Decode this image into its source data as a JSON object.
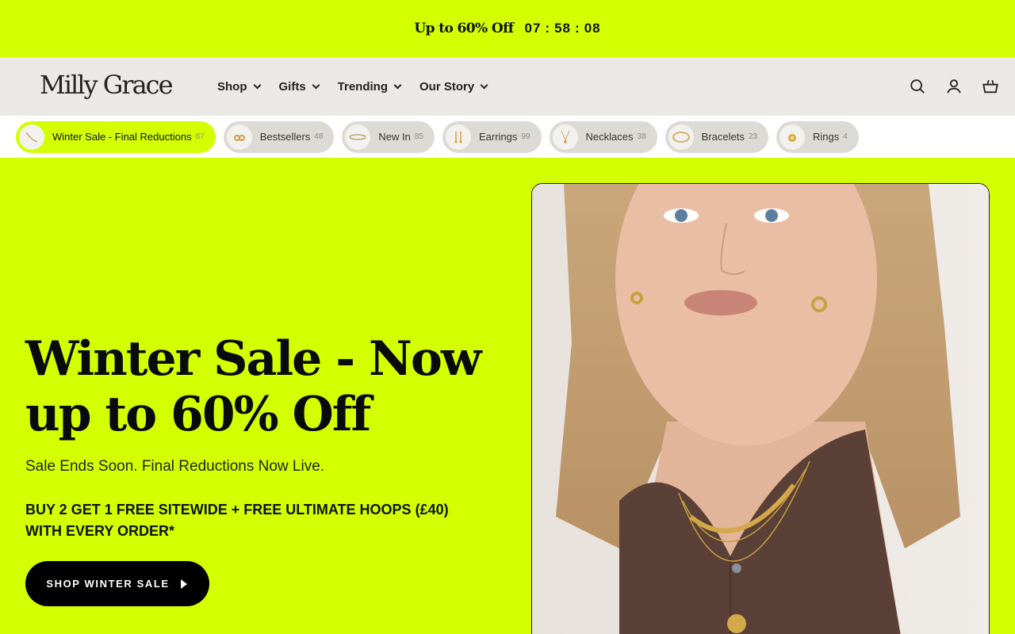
{
  "announcement": {
    "promo": "Up to 60% Off",
    "timer": {
      "hours": "07",
      "minutes": "58",
      "seconds": "08"
    }
  },
  "brand": {
    "logo": "Milly Grace"
  },
  "nav": [
    {
      "label": "Shop"
    },
    {
      "label": "Gifts"
    },
    {
      "label": "Trending"
    },
    {
      "label": "Our Story"
    }
  ],
  "header_icons": [
    "search-icon",
    "account-icon",
    "basket-icon"
  ],
  "chips": [
    {
      "label": "Winter Sale - Final Reductions",
      "count": "67",
      "active": true
    },
    {
      "label": "Bestsellers",
      "count": "48"
    },
    {
      "label": "New In",
      "count": "85"
    },
    {
      "label": "Earrings",
      "count": "99"
    },
    {
      "label": "Necklaces",
      "count": "38"
    },
    {
      "label": "Bracelets",
      "count": "23"
    },
    {
      "label": "Rings",
      "count": "4"
    }
  ],
  "hero": {
    "title": "Winter Sale - Now up to 60% Off",
    "subtitle": "Sale Ends Soon. Final Reductions Now Live.",
    "offer": "BUY 2 GET 1 FREE SITEWIDE + FREE ULTIMATE HOOPS (£40) WITH EVERY ORDER*",
    "cta": "SHOP WINTER SALE"
  },
  "colors": {
    "accent": "#d3ff00",
    "header_bg": "#ebe9e5",
    "chip_bg": "#dcdad5",
    "cta_bg": "#000000"
  }
}
